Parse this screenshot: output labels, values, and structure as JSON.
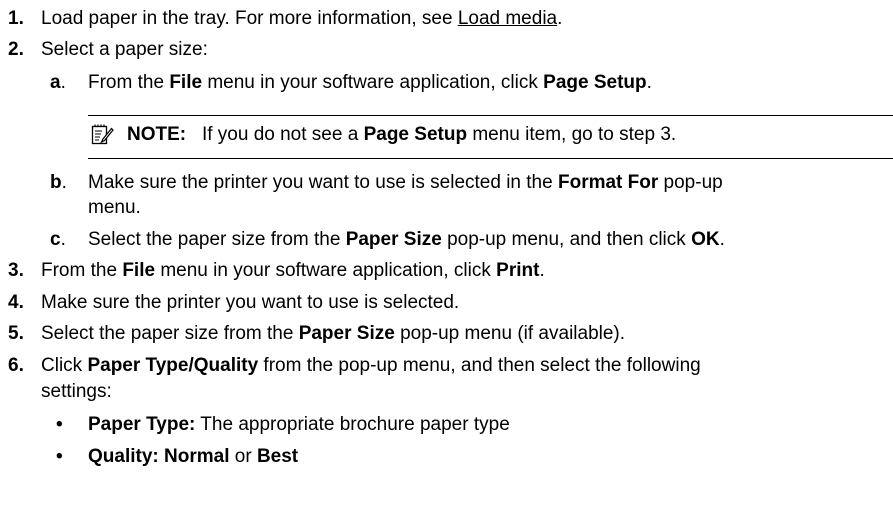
{
  "steps": {
    "s1": {
      "num": "1.",
      "pre": "Load paper in the tray. For more information, see ",
      "link": "Load media",
      "post": "."
    },
    "s2": {
      "num": "2.",
      "text": "Select a paper size:"
    },
    "s2a": {
      "letter": "a",
      "dot": ".",
      "t1": "From the ",
      "b1": "File",
      "t2": " menu in your software application, click ",
      "b2": "Page Setup",
      "t3": "."
    },
    "note": {
      "icon": "note-pencil-icon",
      "label": "NOTE:",
      "t1": "If you do not see a ",
      "b1": "Page Setup",
      "t2": " menu item, go to step 3."
    },
    "s2b": {
      "letter": "b",
      "dot": ".",
      "t1": "Make sure the printer you want to use is selected in the ",
      "b1": "Format For",
      "t2": " pop-up",
      "line2": "menu."
    },
    "s2c": {
      "letter": "c",
      "dot": ".",
      "t1": "Select the paper size from the ",
      "b1": "Paper Size",
      "t2": " pop-up menu, and then click ",
      "b2": "OK",
      "t3": "."
    },
    "s3": {
      "num": "3.",
      "t1": "From the ",
      "b1": "File",
      "t2": " menu in your software application, click ",
      "b2": "Print",
      "t3": "."
    },
    "s4": {
      "num": "4.",
      "text": "Make sure the printer you want to use is selected."
    },
    "s5": {
      "num": "5.",
      "t1": "Select the paper size from the ",
      "b1": "Paper Size",
      "t2": " pop-up menu (if available)."
    },
    "s6": {
      "num": "6.",
      "t1": "Click ",
      "b1": "Paper Type/Quality",
      "t2": " from the pop-up menu, and then select the following",
      "line2": "settings:"
    },
    "bullets": [
      {
        "symbol": "•",
        "label": "Paper Type:",
        "text": " The appropriate brochure paper type"
      },
      {
        "symbol": "•",
        "label": "Quality:",
        "t1": " ",
        "b1": "Normal",
        "t2": " or ",
        "b2": "Best"
      }
    ]
  }
}
